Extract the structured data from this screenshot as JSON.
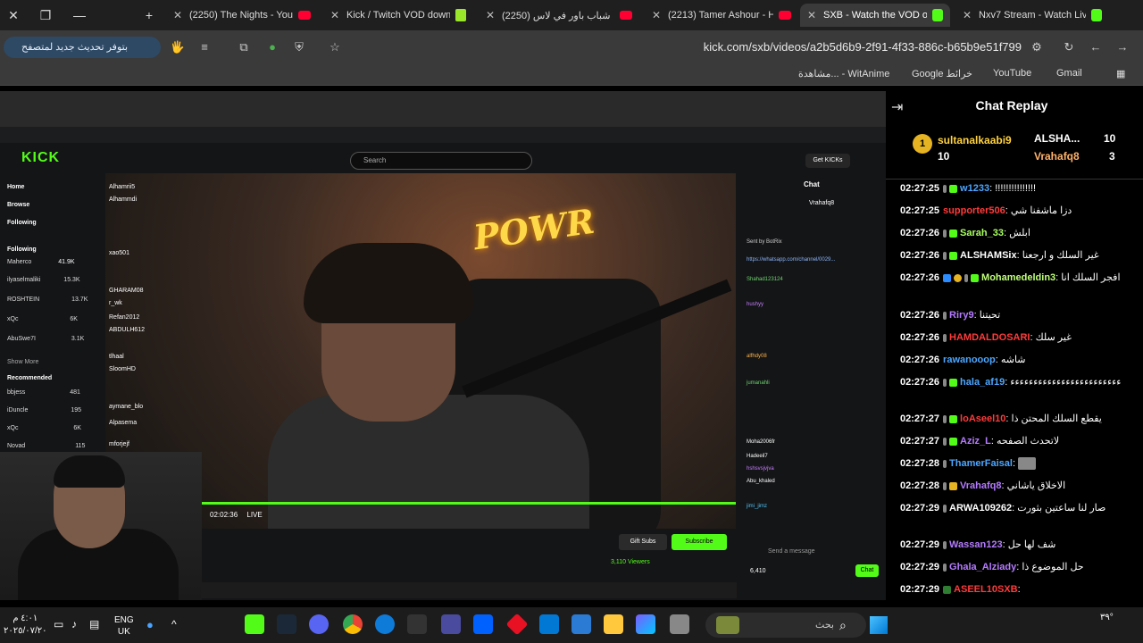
{
  "tabs": [
    {
      "title": "(2250) The Nights - YouTube",
      "favicon": "youtube-icon",
      "active": false
    },
    {
      "title": "Kick / Twitch VOD downloader",
      "favicon": "download-icon",
      "active": false
    },
    {
      "title": "(2250) شباب باور في لاس",
      "favicon": "youtube-icon",
      "active": false
    },
    {
      "title": "(2213) Tamer Ashour - Hay",
      "favicon": "youtube-icon",
      "active": false
    },
    {
      "title": "SXB - Watch the VOD on",
      "favicon": "kick-icon",
      "active": true
    },
    {
      "title": "Nxv7 Stream - Watch Live",
      "favicon": "kick-icon",
      "active": false
    }
  ],
  "toolbar": {
    "update_label": "بتوفر تحديث جديد لمتصفح Chrome",
    "url": "kick.com/sxb/videos/a2b5d6b9-2f91-4f33-886c-b65b9e51f799"
  },
  "bookmarks": [
    {
      "label": "Gmail"
    },
    {
      "label": "YouTube"
    },
    {
      "label": "Google خرائط"
    },
    {
      "label": "مشاهدة... - WitAnime"
    }
  ],
  "inner": {
    "search_placeholder": "Search",
    "get_kicks": "Get KICKs",
    "sidebar": {
      "home": "Home",
      "browse": "Browse",
      "following": "Following",
      "following_header": "Following",
      "show_more": "Show More",
      "recommended": "Recommended",
      "followed": [
        {
          "name": "Maherco",
          "game": "Call of Duty: Black",
          "viewers": "41.9K"
        },
        {
          "name": "ilyaselmaliki",
          "game": "Grand Theft Auto V",
          "viewers": "15.3K"
        },
        {
          "name": "ROSHTEIN",
          "game": "Slots & Casino",
          "viewers": "13.7K"
        },
        {
          "name": "xQc",
          "game": "Just Chatting",
          "viewers": "6K"
        },
        {
          "name": "AbuSwe7I",
          "game": "Just Chatting",
          "viewers": "3.1K"
        }
      ],
      "recommended_list": [
        {
          "name": "bbjess",
          "game": "Just Chatting",
          "viewers": "481"
        },
        {
          "name": "iDuncle",
          "game": "IRL",
          "viewers": "195"
        },
        {
          "name": "xQc",
          "game": "Just Chatting",
          "viewers": "6K"
        },
        {
          "name": "Novad",
          "game": "Just Chatting",
          "viewers": "115"
        }
      ]
    },
    "overlay_chat": [
      {
        "user": "Alhammdi",
        "color": "#6fd36f"
      },
      {
        "user": "Alhamrii5",
        "color": "#6fd36f"
      },
      {
        "user": "xao501",
        "color": "#fff"
      },
      {
        "user": "GHARAM08",
        "color": "#ffb347"
      },
      {
        "user": "r_wk",
        "color": "#fff"
      },
      {
        "user": "Refan2012",
        "color": "#ff6b6b"
      },
      {
        "user": "ABDULH612",
        "color": "#fff"
      },
      {
        "user": "tlhaal",
        "color": "#fff"
      },
      {
        "user": "SloomHD",
        "color": "#4fc3f7"
      },
      {
        "user": "Alpasema",
        "color": "#ffb347"
      },
      {
        "user": "mforjejf",
        "color": "#fff"
      },
      {
        "user": "aymane_blo",
        "color": "#fff"
      }
    ],
    "live_time": "02:02:36",
    "live_label": "LIVE",
    "gift_subs": "Gift Subs",
    "subscribe": "Subscribe",
    "viewers": "3,110 Viewers",
    "chat_title": "Chat",
    "send_placeholder": "Send a message",
    "chat_btn": "Chat",
    "points": "6,410",
    "inner_chat": [
      {
        "user": "Shahad123124",
        "color": "#6fd36f"
      },
      {
        "user": "hushyy",
        "color": "#c77dff"
      },
      {
        "user": "alfhdy08",
        "color": "#ffb347"
      },
      {
        "user": "jumanahli",
        "color": "#6fd36f"
      },
      {
        "user": "Moha2006fr",
        "color": "#fff"
      },
      {
        "user": "Hadeeil7",
        "color": "#fff"
      },
      {
        "user": "hshsvsjvjva",
        "color": "#c77dff"
      },
      {
        "user": "Abu_khaled",
        "color": "#fff"
      },
      {
        "user": "jimi_jimz",
        "color": "#4fc3f7"
      }
    ],
    "inner_top": {
      "name": "Vrahafq8",
      "count": "1"
    },
    "pinned": {
      "title": "Sent by BotRix",
      "link": "https://whatsapp.com/channel/0029..."
    }
  },
  "chat_replay": {
    "title": "Chat Replay",
    "gifters": [
      {
        "name": "sultanalkaabi9",
        "count": "10"
      },
      {
        "name": "ALSHA...",
        "count": "10"
      },
      {
        "name": "Vrahafq8",
        "count": "3"
      }
    ],
    "messages": [
      {
        "time": "02:27:25",
        "user": "w1233",
        "color": "#4da6ff",
        "text": "!!!!!!!!!!!!!!!"
      },
      {
        "time": "02:27:25",
        "user": "supporter506",
        "color": "#ff3b3b",
        "text": "دزا ماشفنا شي"
      },
      {
        "time": "02:27:26",
        "user": "Sarah_33",
        "color": "#a8ff60",
        "text": "ابلش"
      },
      {
        "time": "02:27:26",
        "user": "ALSHAMSix",
        "color": "#ffffff",
        "text": "غير السلك و ارجعنا"
      },
      {
        "time": "02:27:26",
        "user": "Mohamedeldin3",
        "color": "#c0ff7a",
        "text": "افجر السلك انا"
      },
      {
        "time": "02:27:26",
        "user": "Riry9",
        "color": "#b57cff",
        "text": "تحيتنا"
      },
      {
        "time": "02:27:26",
        "user": "HAMDALDOSARI",
        "color": "#ff3b3b",
        "text": "غير سلك"
      },
      {
        "time": "02:27:26",
        "user": "rawanooop",
        "color": "#4da6ff",
        "text": "شاشه"
      },
      {
        "time": "02:27:26",
        "user": "hala_af19",
        "color": "#4da6ff",
        "text": "ءءءءءءءءءءءءءءءءءءءءءءءء"
      },
      {
        "time": "02:27:27",
        "user": "loAseel10",
        "color": "#ff3b3b",
        "text": "يقطع السلك المحتن ذا"
      },
      {
        "time": "02:27:27",
        "user": "Aziz_L",
        "color": "#b57cff",
        "text": "لاتحدث الصفحه"
      },
      {
        "time": "02:27:28",
        "user": "ThamerFaisal",
        "color": "#4da6ff",
        "text": ""
      },
      {
        "time": "02:27:28",
        "user": "Vrahafq8",
        "color": "#b57cff",
        "text": "الاخلاق ياشاني"
      },
      {
        "time": "02:27:29",
        "user": "ARWA109262",
        "color": "#ffffff",
        "text": "صار لنا ساعتين بثورت"
      },
      {
        "time": "02:27:29",
        "user": "Wassan123",
        "color": "#b57cff",
        "text": "شف لها حل"
      },
      {
        "time": "02:27:29",
        "user": "Ghala_Alziady",
        "color": "#b57cff",
        "text": "حل الموضوع ذا"
      },
      {
        "time": "02:27:29",
        "user": "ASEEL10SXB",
        "color": "#ff3b3b",
        "text": ""
      }
    ]
  },
  "taskbar": {
    "time": "٤:٠١ م",
    "date": "٢٠٢٥/٠٧/٢٠",
    "lang1": "ENG",
    "lang2": "UK",
    "search": "بحث",
    "weather": "٣٩°"
  }
}
